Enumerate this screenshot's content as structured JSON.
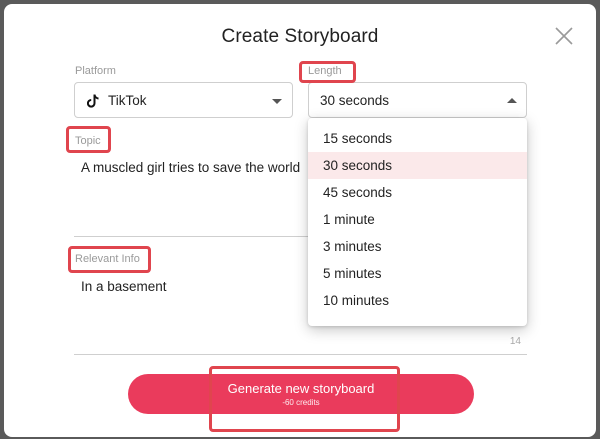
{
  "title": "Create Storyboard",
  "platform": {
    "label": "Platform",
    "value": "TikTok",
    "icon": "tiktok-icon"
  },
  "length": {
    "label": "Length",
    "value": "30 seconds",
    "options": [
      "15 seconds",
      "30 seconds",
      "45 seconds",
      "1 minute",
      "3 minutes",
      "5 minutes",
      "10 minutes"
    ],
    "selected": "30 seconds"
  },
  "topic": {
    "label": "Topic",
    "value": "A muscled girl tries to save the world"
  },
  "relevant_info": {
    "label": "Relevant Info",
    "value": "In a basement",
    "char_count": "14"
  },
  "generate_button": {
    "label": "Generate new storyboard",
    "cost": "-60 credits"
  },
  "colors": {
    "accent": "#ea3b5c",
    "highlight": "#e0454e",
    "selected_option_bg": "#fbe9ea"
  }
}
